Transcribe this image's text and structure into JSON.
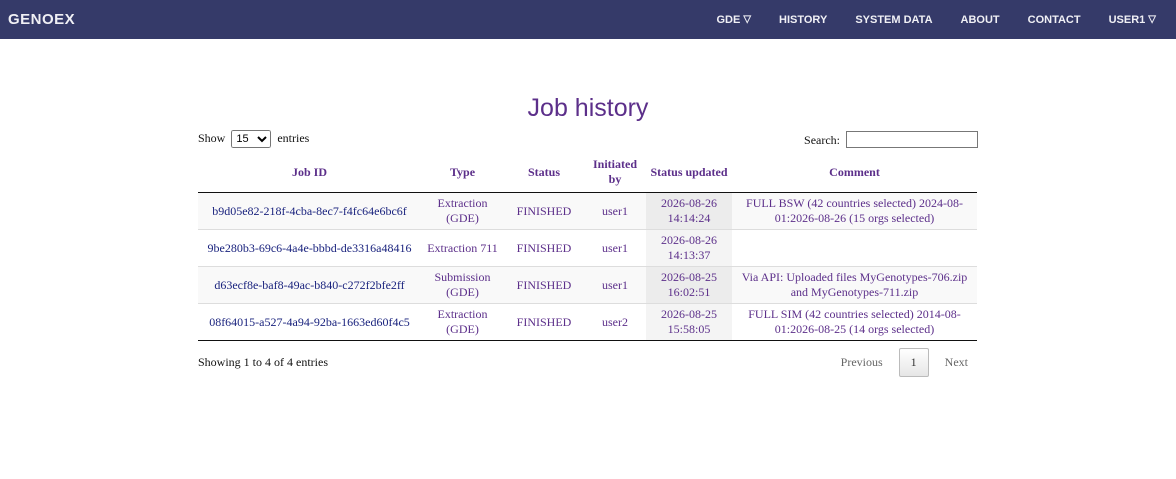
{
  "navbar": {
    "brand": "GENOEX",
    "items": [
      {
        "label": "GDE",
        "caret": "▽"
      },
      {
        "label": "HISTORY"
      },
      {
        "label": "SYSTEM DATA"
      },
      {
        "label": "ABOUT"
      },
      {
        "label": "CONTACT"
      },
      {
        "label": "USER1",
        "caret": "▽"
      }
    ]
  },
  "page": {
    "title": "Job history"
  },
  "controls": {
    "show_label": "Show",
    "entries_value": "15",
    "entries_label": "entries",
    "search_label": "Search:",
    "search_value": ""
  },
  "table": {
    "headers": [
      "Job ID",
      "Type",
      "Status",
      "Initiated by",
      "Status updated",
      "Comment"
    ],
    "rows": [
      {
        "job_id": "b9d05e82-218f-4cba-8ec7-f4fc64e6bc6f",
        "type": "Extraction (GDE)",
        "status": "FINISHED",
        "initiated_by": "user1",
        "updated": "2026-08-26 14:14:24",
        "comment": "FULL BSW (42 countries selected) 2024-08-01:2026-08-26 (15 orgs selected)"
      },
      {
        "job_id": "9be280b3-69c6-4a4e-bbbd-de3316a48416",
        "type": "Extraction 711",
        "status": "FINISHED",
        "initiated_by": "user1",
        "updated": "2026-08-26 14:13:37",
        "comment": ""
      },
      {
        "job_id": "d63ecf8e-baf8-49ac-b840-c272f2bfe2ff",
        "type": "Submission (GDE)",
        "status": "FINISHED",
        "initiated_by": "user1",
        "updated": "2026-08-25 16:02:51",
        "comment": "Via API: Uploaded files MyGenotypes-706.zip and MyGenotypes-711.zip"
      },
      {
        "job_id": "08f64015-a527-4a94-92ba-1663ed60f4c5",
        "type": "Extraction (GDE)",
        "status": "FINISHED",
        "initiated_by": "user2",
        "updated": "2026-08-25 15:58:05",
        "comment": "FULL SIM (42 countries selected) 2014-08-01:2026-08-25 (14 orgs selected)"
      }
    ]
  },
  "footer": {
    "info": "Showing 1 to 4 of 4 entries",
    "previous": "Previous",
    "current_page": "1",
    "next": "Next"
  }
}
